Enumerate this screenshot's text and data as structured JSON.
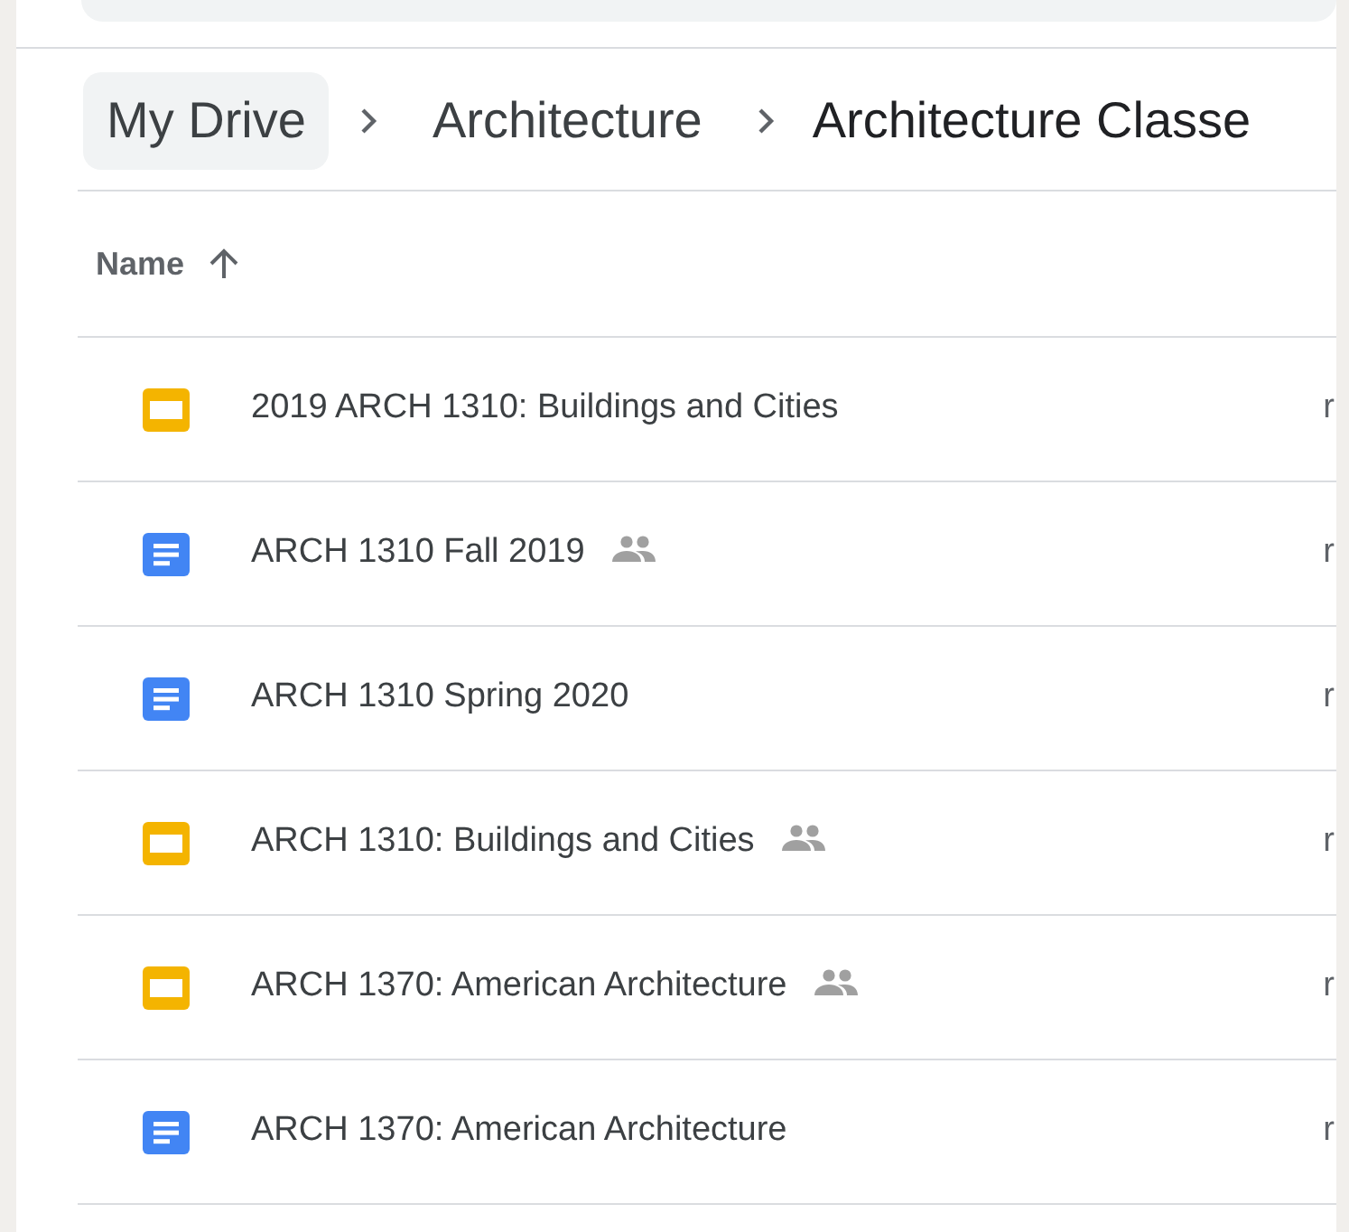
{
  "breadcrumb": [
    {
      "label": "My Drive",
      "selected": false
    },
    {
      "label": "Architecture",
      "selected": false
    },
    {
      "label": "Architecture Classe",
      "selected": true
    }
  ],
  "table": {
    "columns": [
      {
        "label": "Name",
        "sorted": true,
        "descending": false
      }
    ],
    "rows": [
      {
        "kind": "slides",
        "name": "2019 ARCH 1310: Buildings and Cities",
        "shared": false,
        "column_2": "r"
      },
      {
        "kind": "doc",
        "name": "ARCH 1310 Fall 2019",
        "shared": true,
        "column_2": "r"
      },
      {
        "kind": "doc",
        "name": "ARCH 1310 Spring 2020",
        "shared": false,
        "column_2": "r"
      },
      {
        "kind": "slides",
        "name": "ARCH 1310: Buildings and Cities",
        "shared": true,
        "column_2": "r"
      },
      {
        "kind": "slides",
        "name": "ARCH 1370: American Architecture",
        "shared": true,
        "column_2": "r"
      },
      {
        "kind": "doc",
        "name": "ARCH 1370: American Architecture",
        "shared": false,
        "column_2": "r"
      }
    ]
  }
}
